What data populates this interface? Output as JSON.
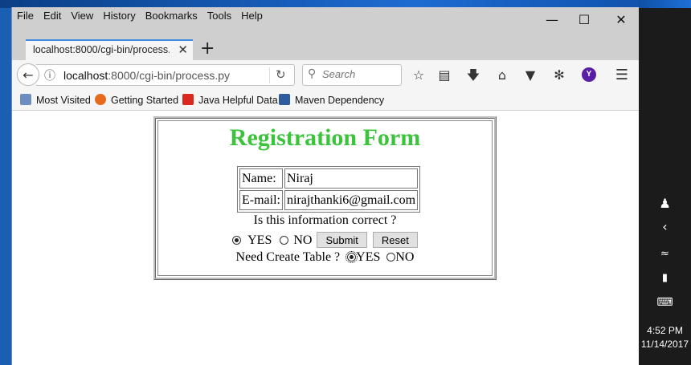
{
  "menu": [
    "File",
    "Edit",
    "View",
    "History",
    "Bookmarks",
    "Tools",
    "Help"
  ],
  "tab": {
    "title": "localhost:8000/cgi-bin/process.py"
  },
  "url": {
    "host": "localhost",
    "rest": ":8000/cgi-bin/process.py"
  },
  "search": {
    "placeholder": "Search"
  },
  "toolbar": {
    "account_letter": "Y"
  },
  "bookmarks": [
    "Most Visited",
    "Getting Started",
    "Java Helpful Data",
    "Maven Dependency"
  ],
  "form": {
    "title": "Registration Form",
    "name_label": "Name:",
    "name_value": "Niraj",
    "email_label": "E-mail:",
    "email_value": "nirajthanki6@gmail.com",
    "question": "Is this information correct ?",
    "yes_label": "YES",
    "no_label": "NO",
    "correct_selected": "YES",
    "submit_label": "Submit",
    "reset_label": "Reset",
    "table_question": "Need Create Table ?",
    "table_yes_label": "YES",
    "table_no_label": "NO",
    "table_selected": "YES"
  },
  "taskbar": {
    "time": "4:52 PM",
    "date": "11/14/2017"
  },
  "colors": {
    "title_green": "#3bc43b",
    "tab_accent": "#3f8ae2",
    "taskbar": "#1b1b1b"
  }
}
